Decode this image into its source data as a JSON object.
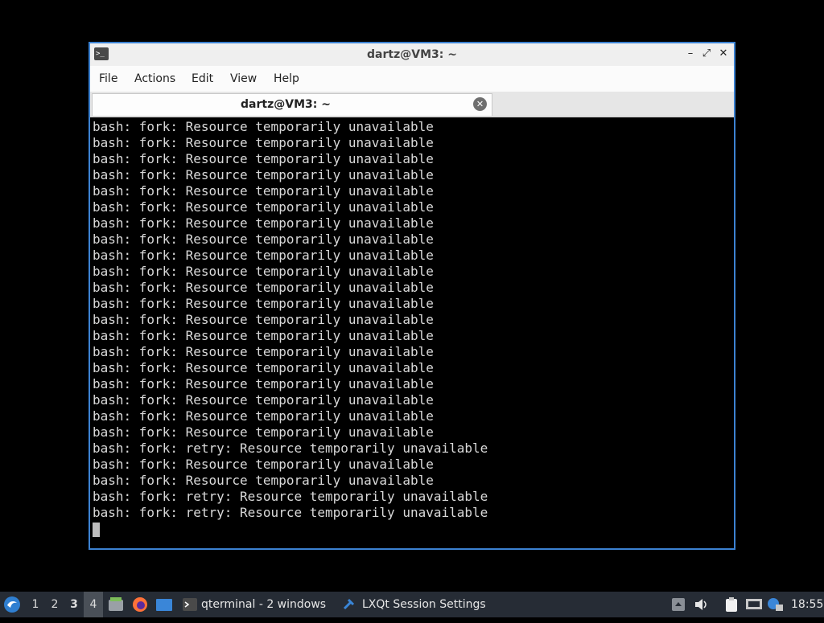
{
  "window": {
    "title": "dartz@VM3: ~",
    "controls": {
      "minimize": "–",
      "maximize": "⤢",
      "close": "✕"
    },
    "menu": [
      "File",
      "Actions",
      "Edit",
      "View",
      "Help"
    ],
    "tab": {
      "label": "dartz@VM3: ~",
      "close": "✕"
    }
  },
  "terminal": {
    "lines": [
      "bash: fork: Resource temporarily unavailable",
      "bash: fork: Resource temporarily unavailable",
      "bash: fork: Resource temporarily unavailable",
      "bash: fork: Resource temporarily unavailable",
      "bash: fork: Resource temporarily unavailable",
      "bash: fork: Resource temporarily unavailable",
      "bash: fork: Resource temporarily unavailable",
      "bash: fork: Resource temporarily unavailable",
      "bash: fork: Resource temporarily unavailable",
      "bash: fork: Resource temporarily unavailable",
      "bash: fork: Resource temporarily unavailable",
      "bash: fork: Resource temporarily unavailable",
      "bash: fork: Resource temporarily unavailable",
      "bash: fork: Resource temporarily unavailable",
      "bash: fork: Resource temporarily unavailable",
      "bash: fork: Resource temporarily unavailable",
      "bash: fork: Resource temporarily unavailable",
      "bash: fork: Resource temporarily unavailable",
      "bash: fork: Resource temporarily unavailable",
      "bash: fork: Resource temporarily unavailable",
      "bash: fork: retry: Resource temporarily unavailable",
      "bash: fork: Resource temporarily unavailable",
      "bash: fork: Resource temporarily unavailable",
      "bash: fork: retry: Resource temporarily unavailable",
      "bash: fork: retry: Resource temporarily unavailable"
    ]
  },
  "taskbar": {
    "workspaces": [
      "1",
      "2",
      "3",
      "4"
    ],
    "current_workspace": "3",
    "active_workspace": "4",
    "tasks": [
      {
        "label": "qterminal - 2 windows",
        "icon": "terminal-icon"
      },
      {
        "label": "LXQt Session Settings",
        "icon": "session-settings-icon"
      }
    ],
    "clock": "18:55"
  },
  "colors": {
    "accent": "#3c82d2",
    "taskbar": "#262c35",
    "terminal_fg": "#d9d9d9"
  }
}
